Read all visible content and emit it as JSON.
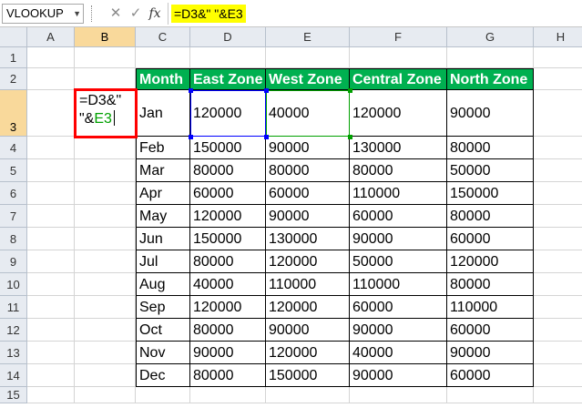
{
  "name_box": "VLOOKUP",
  "toolbar": {
    "cancel_glyph": "✕",
    "enter_glyph": "✓",
    "fx_label": "fx"
  },
  "formula": "=D3&\" \"&E3",
  "columns": [
    "A",
    "B",
    "C",
    "D",
    "E",
    "F",
    "G",
    "H"
  ],
  "rows": [
    "1",
    "2",
    "3",
    "4",
    "5",
    "6",
    "7",
    "8",
    "9",
    "10",
    "11",
    "12",
    "13",
    "14",
    "15"
  ],
  "active_column": "B",
  "active_row": "3",
  "edit_cell": {
    "line1": "=D3&\"",
    "line2_prefix": "\"&",
    "line2_ref": "E3"
  },
  "table": {
    "headers": [
      "Month",
      "East Zone",
      "West Zone",
      "Central Zone",
      "North Zone"
    ],
    "rows": [
      [
        "Jan",
        "120000",
        "40000",
        "120000",
        "90000"
      ],
      [
        "Feb",
        "150000",
        "90000",
        "130000",
        "80000"
      ],
      [
        "Mar",
        "80000",
        "80000",
        "80000",
        "50000"
      ],
      [
        "Apr",
        "60000",
        "60000",
        "110000",
        "150000"
      ],
      [
        "May",
        "120000",
        "90000",
        "60000",
        "80000"
      ],
      [
        "Jun",
        "150000",
        "130000",
        "90000",
        "60000"
      ],
      [
        "Jul",
        "80000",
        "120000",
        "50000",
        "120000"
      ],
      [
        "Aug",
        "40000",
        "110000",
        "110000",
        "80000"
      ],
      [
        "Sep",
        "120000",
        "120000",
        "60000",
        "110000"
      ],
      [
        "Oct",
        "80000",
        "90000",
        "90000",
        "60000"
      ],
      [
        "Nov",
        "90000",
        "120000",
        "40000",
        "90000"
      ],
      [
        "Dec",
        "80000",
        "150000",
        "90000",
        "60000"
      ]
    ]
  },
  "colors": {
    "header_fill": "#00b050",
    "edit_border": "#ff0000",
    "formula_highlight": "#ffff00",
    "ref_d3": "#0000ff",
    "ref_e3": "#00a000",
    "selected_header": "#f9d99b"
  }
}
